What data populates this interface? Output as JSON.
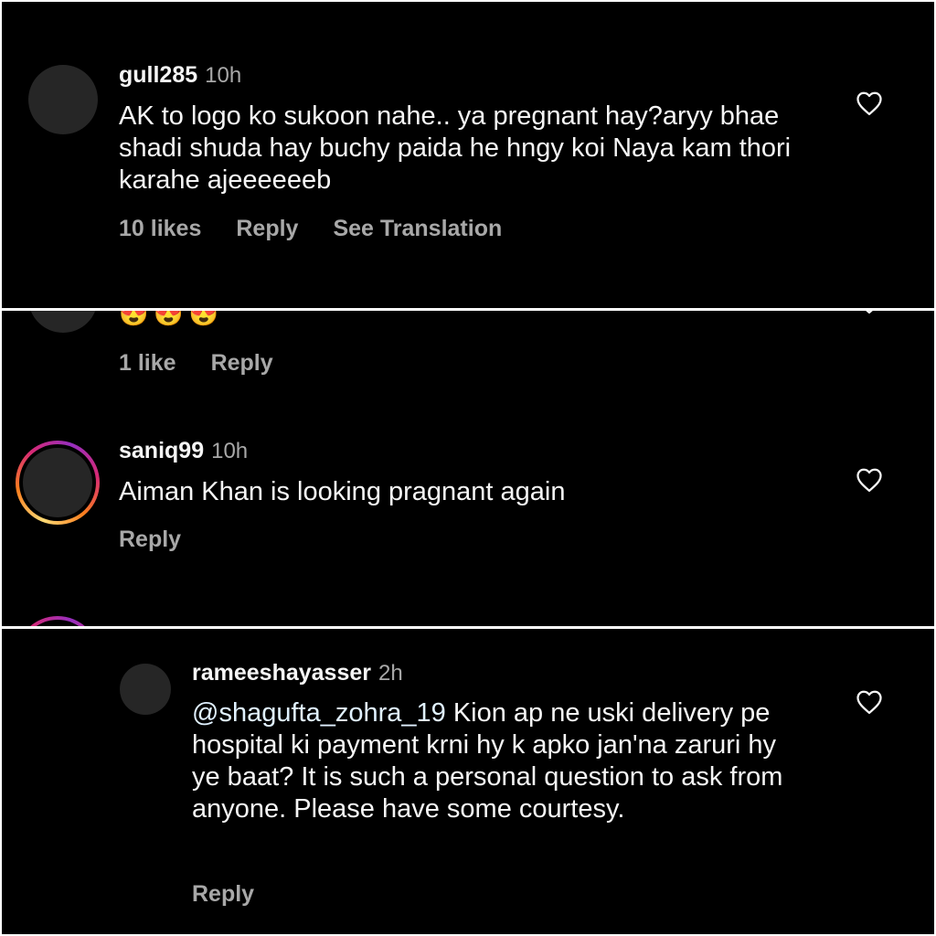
{
  "comments": [
    {
      "username": "gull285",
      "time": "10h",
      "text": "AK to logo ko sukoon nahe.. ya pregnant hay?aryy bhae shadi shuda hay buchy paida he hngy koi Naya kam thori karahe ajeeeeeeb",
      "likes": "10 likes",
      "reply": "Reply",
      "translation": "See Translation"
    },
    {
      "emojis": "😍😍😍",
      "likes": "1 like",
      "reply": "Reply"
    },
    {
      "username": "saniq99",
      "time": "10h",
      "text": "Aiman Khan is looking pragnant again",
      "reply": "Reply"
    },
    {
      "username": "rameeshayasser",
      "time": "2h",
      "mention": "@shagufta_zohra_19",
      "text": "Kion ap ne uski delivery pe hospital ki payment krni hy k apko jan'na zaruri hy ye baat? It is such a personal question to ask from anyone. Please have some courtesy.",
      "reply": "Reply"
    }
  ],
  "icons": {
    "like": "heart-outline-icon"
  },
  "colors": {
    "background": "#000000",
    "text": "#f5f5f5",
    "muted": "#a8a8a8",
    "mention": "#e0f1ff"
  }
}
